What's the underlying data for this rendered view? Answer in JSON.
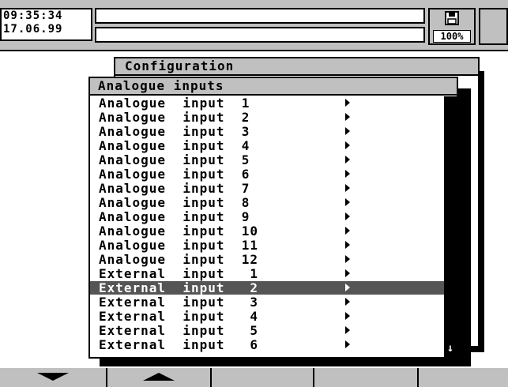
{
  "header": {
    "time": "09:35:34",
    "date": "17.06.99",
    "zoom": "100%",
    "icon": "floppy-disk-icon"
  },
  "config_window": {
    "title": "Configuration"
  },
  "analogue_window": {
    "title": "Analogue  inputs",
    "items": [
      {
        "label": "Analogue  input  1"
      },
      {
        "label": "Analogue  input  2"
      },
      {
        "label": "Analogue  input  3"
      },
      {
        "label": "Analogue  input  4"
      },
      {
        "label": "Analogue  input  5"
      },
      {
        "label": "Analogue  input  6"
      },
      {
        "label": "Analogue  input  7"
      },
      {
        "label": "Analogue  input  8"
      },
      {
        "label": "Analogue  input  9"
      },
      {
        "label": "Analogue  input  10"
      },
      {
        "label": "Analogue  input  11"
      },
      {
        "label": "Analogue  input  12"
      },
      {
        "label": "External  input   1"
      },
      {
        "label": "External  input   2",
        "selected": true
      },
      {
        "label": "External  input   3"
      },
      {
        "label": "External  input   4"
      },
      {
        "label": "External  input   5"
      },
      {
        "label": "External  input   6"
      }
    ],
    "scroll_down_icon": "↓"
  },
  "footer": {
    "keys": [
      "chevron-down-icon",
      "chevron-up-icon",
      "",
      "",
      ""
    ]
  }
}
